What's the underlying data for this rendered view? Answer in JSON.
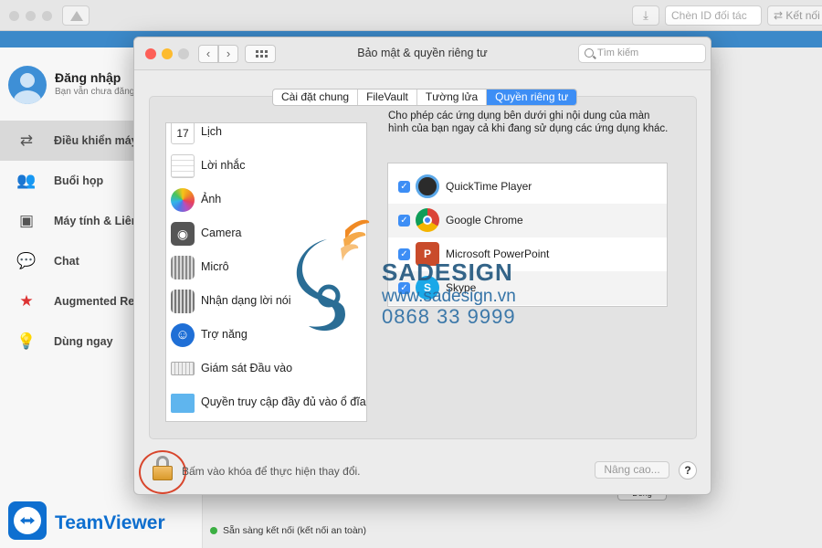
{
  "teamviewer": {
    "partner_id_placeholder": "Chèn ID đối tác",
    "connect_label": "Kết nối",
    "user_name": "Đăng nhập",
    "user_status": "Bạn vẫn chưa đăng nhập",
    "nav": [
      {
        "label": "Điều khiển máy tính từ xa",
        "icon": "arrows-icon"
      },
      {
        "label": "Buổi họp",
        "icon": "people-icon"
      },
      {
        "label": "Máy tính & Liên hệ",
        "icon": "contacts-icon"
      },
      {
        "label": "Chat",
        "icon": "chat-icon"
      },
      {
        "label": "Augmented Reality",
        "icon": "ar-icon"
      },
      {
        "label": "Dùng ngay",
        "icon": "lightbulb-icon"
      }
    ],
    "brand": "TeamViewer",
    "status_text": "Sẵn sàng kết nối (kết nối an toàn)",
    "close_label": "Đóng"
  },
  "prefs": {
    "title": "Bảo mật & quyền riêng tư",
    "search_placeholder": "Tìm kiếm",
    "tabs": [
      "Cài đặt chung",
      "FileVault",
      "Tường lửa",
      "Quyền riêng tư"
    ],
    "active_tab": 3,
    "categories": [
      {
        "label": "Lịch",
        "icon": "calendar-icon"
      },
      {
        "label": "Lời nhắc",
        "icon": "reminders-icon"
      },
      {
        "label": "Ảnh",
        "icon": "photos-icon"
      },
      {
        "label": "Camera",
        "icon": "camera-icon"
      },
      {
        "label": "Micrô",
        "icon": "microphone-icon"
      },
      {
        "label": "Nhận dạng lời nói",
        "icon": "speech-recognition-icon"
      },
      {
        "label": "Trợ năng",
        "icon": "accessibility-icon"
      },
      {
        "label": "Giám sát Đầu vào",
        "icon": "keyboard-icon"
      },
      {
        "label": "Quyền truy cập đầy đủ vào ổ đĩa",
        "icon": "folder-icon"
      }
    ],
    "description": "Cho phép các ứng dụng bên dưới ghi nội dung của màn hình của bạn ngay cả khi đang sử dụng các ứng dụng khác.",
    "apps": [
      {
        "label": "QuickTime Player",
        "checked": true,
        "icon": "quicktime-icon"
      },
      {
        "label": "Google Chrome",
        "checked": true,
        "icon": "chrome-icon"
      },
      {
        "label": "Microsoft PowerPoint",
        "checked": true,
        "icon": "powerpoint-icon"
      },
      {
        "label": "Skype",
        "checked": true,
        "icon": "skype-icon"
      }
    ],
    "lock_text": "Bấm vào khóa để thực hiện thay đổi.",
    "advanced_label": "Nâng cao...",
    "help_label": "?"
  },
  "watermark": {
    "brand": "SADESIGN",
    "url": "www.sadesign.vn",
    "phone": "0868 33 9999"
  }
}
